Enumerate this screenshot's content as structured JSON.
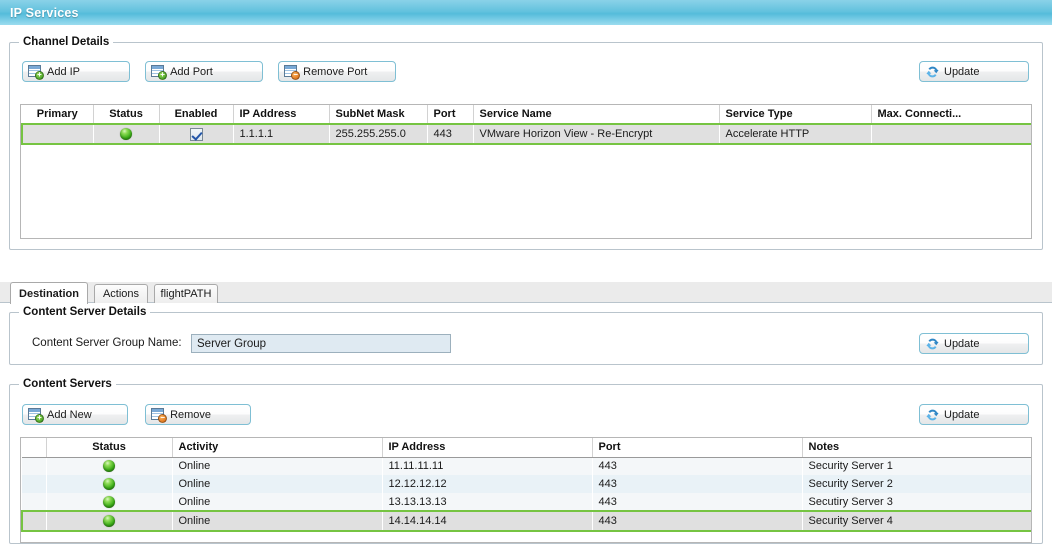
{
  "window": {
    "title": "IP Services",
    "accent_color": "#63c2de",
    "selection_border_color": "#76c442"
  },
  "channel_details": {
    "legend": "Channel Details",
    "toolbar": {
      "add_ip": "Add IP",
      "add_port": "Add Port",
      "remove_port": "Remove Port",
      "update": "Update"
    },
    "columns": [
      "Primary",
      "Status",
      "Enabled",
      "IP Address",
      "SubNet Mask",
      "Port",
      "Service Name",
      "Service Type",
      "Max. Connecti..."
    ],
    "rows": [
      {
        "primary": "",
        "status": "online",
        "enabled": true,
        "ip_address": "1.1.1.1",
        "subnet_mask": "255.255.255.0",
        "port": "443",
        "service_name": "VMware Horizon View - Re-Encrypt",
        "service_type": "Accelerate HTTP",
        "max_connections": "",
        "selected": true
      }
    ]
  },
  "tabs": [
    {
      "label": "Destination",
      "active": true
    },
    {
      "label": "Actions",
      "active": false
    },
    {
      "label": "flightPATH",
      "active": false
    }
  ],
  "content_server_details": {
    "legend": "Content Server Details",
    "group_name_label": "Content Server Group Name:",
    "group_name_value": "Server Group",
    "group_name_placeholder": "",
    "update": "Update"
  },
  "content_servers": {
    "legend": "Content Servers",
    "toolbar": {
      "add_new": "Add New",
      "remove": "Remove",
      "update": "Update"
    },
    "columns": [
      "",
      "Status",
      "Activity",
      "IP Address",
      "Port",
      "Notes"
    ],
    "rows": [
      {
        "status": "online",
        "activity": "Online",
        "ip_address": "11.11.11.11",
        "port": "443",
        "notes": "Security Server 1",
        "selected": false
      },
      {
        "status": "online",
        "activity": "Online",
        "ip_address": "12.12.12.12",
        "port": "443",
        "notes": "Security Server 2",
        "selected": false
      },
      {
        "status": "online",
        "activity": "Online",
        "ip_address": "13.13.13.13",
        "port": "443",
        "notes": "Secutiry Server 3",
        "selected": false
      },
      {
        "status": "online",
        "activity": "Online",
        "ip_address": "14.14.14.14",
        "port": "443",
        "notes": "Security Server 4",
        "selected": true
      }
    ]
  }
}
